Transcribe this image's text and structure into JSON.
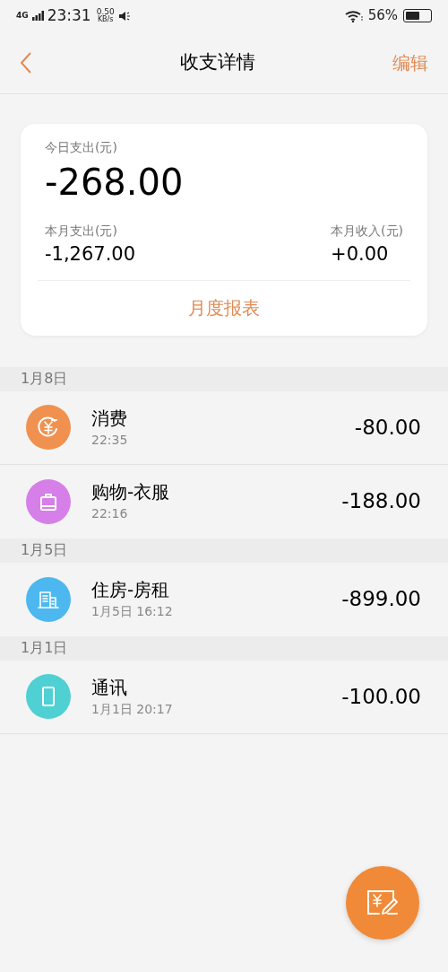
{
  "status_bar": {
    "network": "4G",
    "time": "23:31",
    "speed_value": "0.50",
    "speed_unit": "KB/s",
    "battery": "56%"
  },
  "header": {
    "title": "收支详情",
    "action": "编辑"
  },
  "summary": {
    "today_label": "今日支出(元)",
    "today_value": "-268.00",
    "month_expense_label": "本月支出(元)",
    "month_expense_value": "-1,267.00",
    "month_income_label": "本月收入(元)",
    "month_income_value": "+0.00",
    "report_link": "月度报表"
  },
  "groups": [
    {
      "date": "1月8日",
      "items": [
        {
          "kind": "consume",
          "color": "#f0914f",
          "title": "消费",
          "time": "22:35",
          "amount": "-80.00"
        },
        {
          "kind": "shopping",
          "color": "#d77fe8",
          "title": "购物-衣服",
          "time": "22:16",
          "amount": "-188.00"
        }
      ]
    },
    {
      "date": "1月5日",
      "items": [
        {
          "kind": "housing",
          "color": "#4db8f0",
          "title": "住房-房租",
          "time": "1月5日 16:12",
          "amount": "-899.00"
        }
      ]
    },
    {
      "date": "1月1日",
      "items": [
        {
          "kind": "phone",
          "color": "#4fd0d3",
          "title": "通讯",
          "time": "1月1日 20:17",
          "amount": "-100.00"
        }
      ]
    }
  ]
}
